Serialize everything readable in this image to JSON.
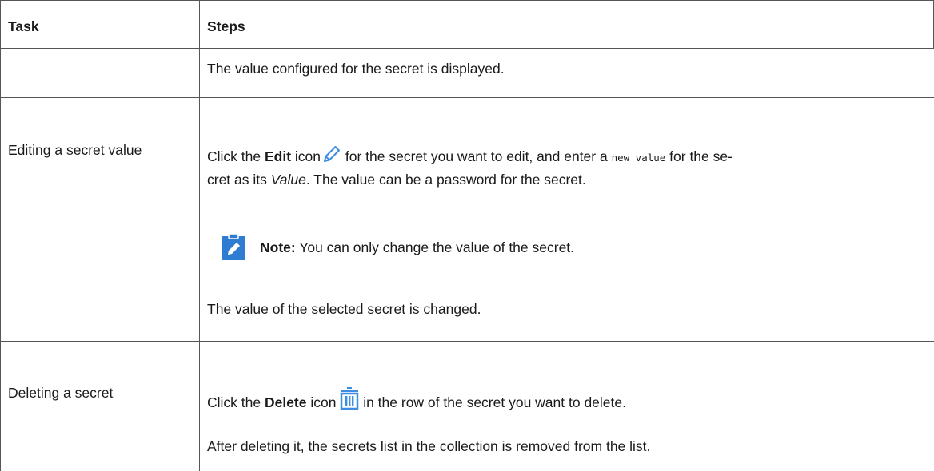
{
  "table": {
    "headers": {
      "task": "Task",
      "steps": "Steps"
    },
    "rows": [
      {
        "task": "",
        "steps": [
          "The value configured for the secret is displayed."
        ]
      },
      {
        "task": "Editing a secret value",
        "steps_line1": {
          "a": "Click the ",
          "b": "Edit",
          "c": " icon",
          "d": " for the secret you want to edit, and enter a ",
          "code": "new value",
          "e": " for the se-"
        },
        "steps_line2": {
          "a": "cret as its ",
          "b": "Value",
          "c": ". The value can be a password for the secret."
        },
        "note": {
          "label": "Note:",
          "text": " You can only change the value of the secret."
        },
        "result": "The value of the selected secret is changed."
      },
      {
        "task": "Deleting a secret",
        "steps_line1": {
          "a": "Click the ",
          "b": "Delete",
          "c": " icon ",
          "d": " in the row of the secret you want to delete."
        },
        "result": "After deleting it, the secrets list in the collection is removed from the list."
      }
    ]
  },
  "icons": {
    "edit": "pencil-icon",
    "delete": "trash-icon",
    "note": "note-pencil-icon"
  },
  "colors": {
    "icon_blue": "#3d8de5",
    "note_blue": "#2f7dd3",
    "border": "#555555"
  }
}
